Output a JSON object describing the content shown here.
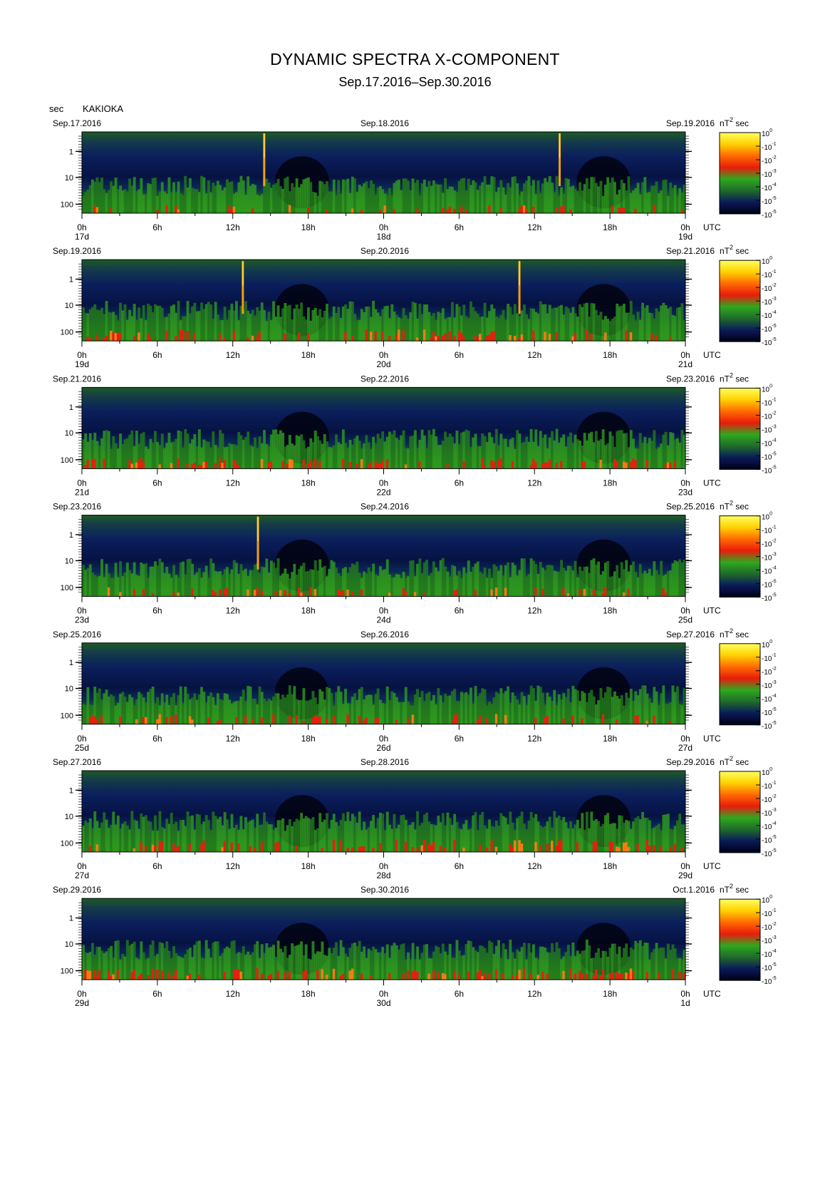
{
  "header": {
    "title": "DYNAMIC SPECTRA X-COMPONENT",
    "subtitle": "Sep.17.2016–Sep.30.2016",
    "y_unit": "sec",
    "station": "KAKIOKA"
  },
  "colors": {
    "scale": [
      "#000014",
      "#0a1a5a",
      "#1f6b2a",
      "#2fa81e",
      "#e81c0c",
      "#ff6a00",
      "#ffd000",
      "#ffff60"
    ],
    "axis": "#000000"
  },
  "chart_data": {
    "type": "heatmap",
    "x_unit": "UTC",
    "period_axis_label": "sec",
    "color_unit_base": "nT",
    "color_unit_exp": "2",
    "color_unit_tail": "sec",
    "y_scale": "log",
    "y_ticks": [
      "1",
      "10",
      "100"
    ],
    "x_tick_labels": [
      "0h",
      "6h",
      "12h",
      "18h",
      "0h",
      "6h",
      "12h",
      "18h",
      "0h"
    ],
    "colorbar_ticks": [
      {
        "base": "10",
        "exp": "0"
      },
      {
        "base": "-10",
        "exp": "-1"
      },
      {
        "base": "-10",
        "exp": "-2"
      },
      {
        "base": "-10",
        "exp": "-3"
      },
      {
        "base": "-10",
        "exp": "-4"
      },
      {
        "base": "-10",
        "exp": "-5"
      },
      {
        "base": "-10",
        "exp": "-5"
      }
    ],
    "panels": [
      {
        "date_left": "Sep.17.2016",
        "date_mid": "Sep.18.2016",
        "date_right": "Sep.19.2016",
        "day_left": "17d",
        "day_mid": "18d",
        "day_right": "19d",
        "activity": 0.25,
        "spikes": [
          14.5,
          38.0
        ]
      },
      {
        "date_left": "Sep.19.2016",
        "date_mid": "Sep.20.2016",
        "date_right": "Sep.21.2016",
        "day_left": "19d",
        "day_mid": "20d",
        "day_right": "21d",
        "activity": 0.55,
        "spikes": [
          12.8,
          34.8
        ]
      },
      {
        "date_left": "Sep.21.2016",
        "date_mid": "Sep.22.2016",
        "date_right": "Sep.23.2016",
        "day_left": "21d",
        "day_mid": "22d",
        "day_right": "23d",
        "activity": 0.5,
        "spikes": []
      },
      {
        "date_left": "Sep.23.2016",
        "date_mid": "Sep.24.2016",
        "date_right": "Sep.25.2016",
        "day_left": "23d",
        "day_mid": "24d",
        "day_right": "25d",
        "activity": 0.35,
        "spikes": [
          14.0
        ]
      },
      {
        "date_left": "Sep.25.2016",
        "date_mid": "Sep.26.2016",
        "date_right": "Sep.27.2016",
        "day_left": "25d",
        "day_mid": "26d",
        "day_right": "27d",
        "activity": 0.4,
        "spikes": []
      },
      {
        "date_left": "Sep.27.2016",
        "date_mid": "Sep.28.2016",
        "date_right": "Sep.29.2016",
        "day_left": "27d",
        "day_mid": "28d",
        "day_right": "29d",
        "activity": 0.65,
        "spikes": []
      },
      {
        "date_left": "Sep.29.2016",
        "date_mid": "Sep.30.2016",
        "date_right": "Oct.1.2016",
        "day_left": "29d",
        "day_mid": "30d",
        "day_right": "1d",
        "activity": 0.55,
        "spikes": []
      }
    ]
  }
}
